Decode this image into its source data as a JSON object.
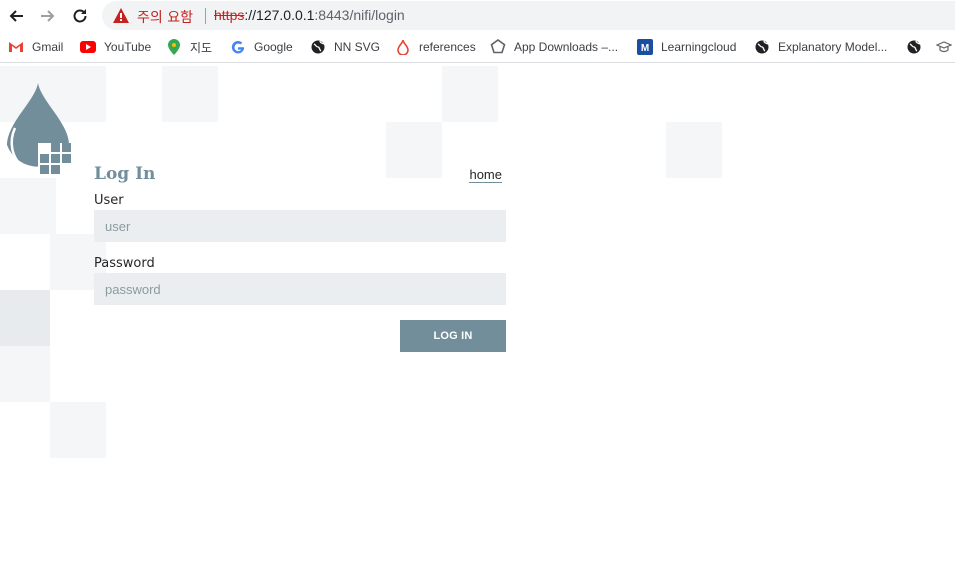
{
  "browser": {
    "warning_text": "주의 요함",
    "url": {
      "scheme": "https",
      "host": "://127.0.0.1",
      "rest": ":8443/nifi/login"
    },
    "bookmarks": [
      {
        "label": "Gmail",
        "icon": "gmail-icon",
        "color": "#ea4335"
      },
      {
        "label": "YouTube",
        "icon": "youtube-icon",
        "color": "#ff0000"
      },
      {
        "label": "지도",
        "icon": "maps-icon",
        "color": "#34a853"
      },
      {
        "label": "Google",
        "icon": "google-icon",
        "color": "#4285f4"
      },
      {
        "label": "NN SVG",
        "icon": "globe-icon",
        "color": "#202124"
      },
      {
        "label": "references",
        "icon": "refs-icon",
        "color": "#ea4335"
      },
      {
        "label": "App Downloads –...",
        "icon": "app-icon",
        "color": "#5f6368"
      },
      {
        "label": "Learningcloud",
        "icon": "m-icon",
        "color": "#1a4fa0"
      },
      {
        "label": "Explanatory Model...",
        "icon": "globe-icon",
        "color": "#202124"
      }
    ]
  },
  "login": {
    "title": "Log In",
    "home_link": "home",
    "user_label": "User",
    "user_placeholder": "user",
    "password_label": "Password",
    "password_placeholder": "password",
    "submit_label": "LOG IN"
  },
  "colors": {
    "accent": "#728e9b",
    "input_bg": "#eaeef0",
    "tile": "#f4f6f7"
  }
}
